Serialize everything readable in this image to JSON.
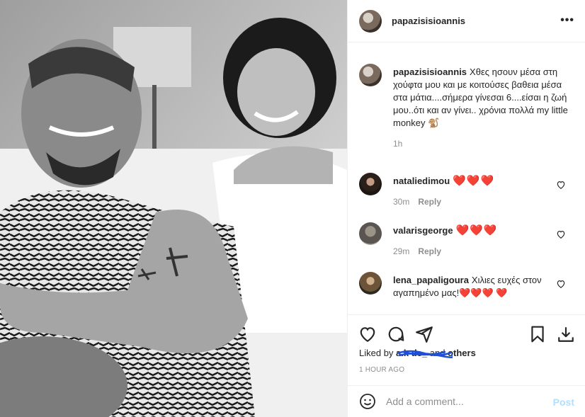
{
  "post": {
    "username": "papazisisioannis"
  },
  "caption": {
    "username": "papazisisioannis",
    "text": "Χθες ησουν μέσα στη χούφτα μου και με κοιτούσες βαθεια μέσα στα μάτια....σήμερα γίνεσαι 6....είσαι η ζωή μου..ότι και αν γίνει.. χρόνια πολλά my little monkey 🐒",
    "time": "1h"
  },
  "comments": [
    {
      "username": "nataliedimou",
      "text": "❤️❤️❤️",
      "time": "30m",
      "reply": "Reply"
    },
    {
      "username": "valarisgeorge",
      "text": "❤️❤️❤️",
      "time": "29m",
      "reply": "Reply"
    },
    {
      "username": "lena_papaligoura",
      "text": "Χιλιες ευχές στον αγαπημένο μας!❤️❤️❤️ ❤️"
    }
  ],
  "likes": {
    "prefix": "Liked by ",
    "user": "a.k          de_",
    "and": " and ",
    "others": "others"
  },
  "timestamp": "1 HOUR AGO",
  "add_comment": {
    "placeholder": "Add a comment...",
    "post_label": "Post"
  },
  "icons": {
    "more": "more-options-icon",
    "like": "heart-icon",
    "comment": "comment-icon",
    "share": "share-icon",
    "save": "bookmark-icon",
    "download": "download-icon",
    "emoji": "emoji-icon"
  },
  "colors": {
    "heart_red": "#ed1c24",
    "post_button": "#b2dffc",
    "scribble_blue": "#1f4fd8"
  }
}
